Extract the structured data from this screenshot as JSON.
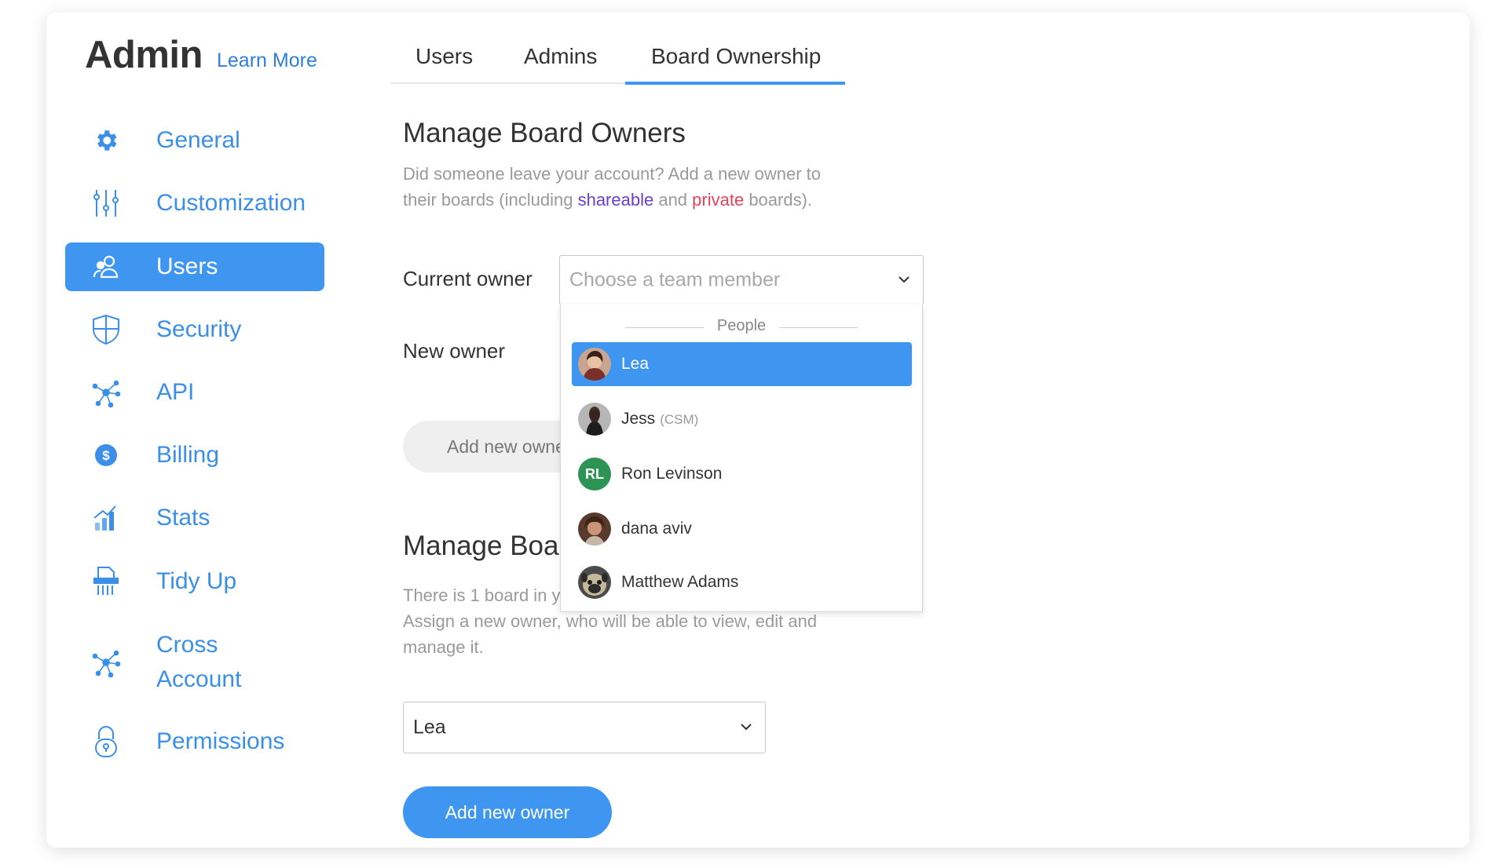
{
  "header": {
    "title": "Admin",
    "learn_more": "Learn More"
  },
  "sidebar": {
    "items": [
      {
        "label": "General",
        "icon": "gear-icon"
      },
      {
        "label": "Customization",
        "icon": "sliders-icon"
      },
      {
        "label": "Users",
        "icon": "users-icon",
        "active": true
      },
      {
        "label": "Security",
        "icon": "shield-icon"
      },
      {
        "label": "API",
        "icon": "network-icon"
      },
      {
        "label": "Billing",
        "icon": "dollar-icon"
      },
      {
        "label": "Stats",
        "icon": "stats-icon"
      },
      {
        "label": "Tidy Up",
        "icon": "shredder-icon"
      },
      {
        "label_line1": "Cross",
        "label_line2": "Account",
        "icon": "network-icon"
      },
      {
        "label": "Permissions",
        "icon": "lock-icon"
      }
    ]
  },
  "tabs": [
    {
      "label": "Users"
    },
    {
      "label": "Admins"
    },
    {
      "label": "Board Ownership",
      "active": true
    }
  ],
  "manage_owners": {
    "title": "Manage Board Owners",
    "desc_line1": "Did someone leave your account? Add a new owner to",
    "desc_line2_a": "their boards (including ",
    "shareable": "shareable",
    "desc_line2_b": " and ",
    "private": "private",
    "desc_line2_c": " boards).",
    "current_owner_label": "Current owner",
    "current_owner_placeholder": "Choose a team member",
    "new_owner_label": "New owner",
    "add_button": "Add new owner"
  },
  "dropdown": {
    "section": "People",
    "options": [
      {
        "name": "Lea",
        "selected": true,
        "avatar": "photo"
      },
      {
        "name": "Jess",
        "tag": "(CSM)",
        "avatar": "photo"
      },
      {
        "name": "Ron Levinson",
        "initials": "RL",
        "avatar_color": "#2e9456"
      },
      {
        "name": "dana aviv",
        "avatar": "photo"
      },
      {
        "name": "Matthew Adams",
        "avatar": "photo"
      }
    ]
  },
  "manage_boards": {
    "title_visible": "Manage Boa",
    "desc_line1_visible": "There is 1 board in y",
    "desc_line2": "Assign a new owner, who will be able to view, edit and",
    "desc_line3": "manage it.",
    "select_value": "Lea",
    "add_button": "Add new owner"
  },
  "colors": {
    "accent": "#3f96f1",
    "link": "#2f7fd9",
    "shareable": "#6a3fc8",
    "private": "#e2445c"
  }
}
